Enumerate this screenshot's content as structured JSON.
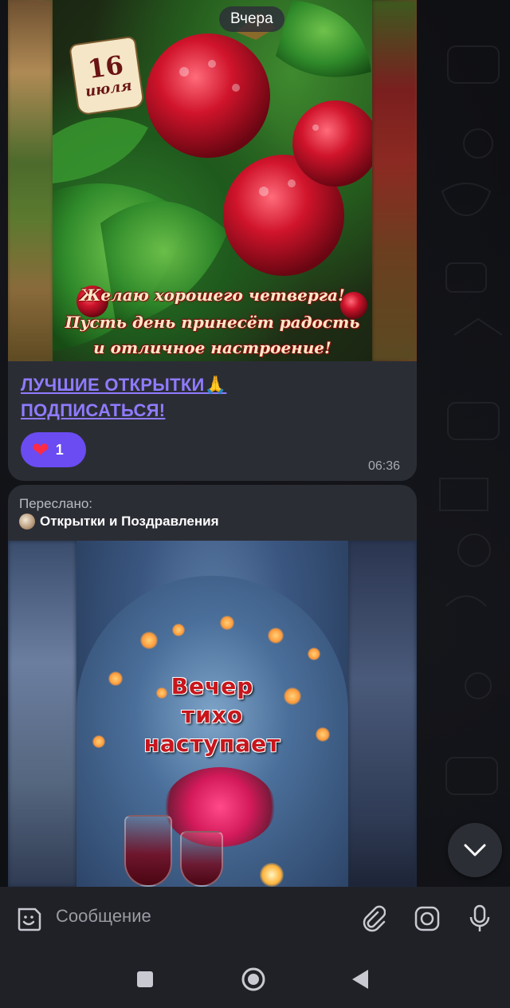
{
  "chat": {
    "date_separator": "Вчера",
    "message1": {
      "card": {
        "date_number": "16",
        "date_month": "июля",
        "greeting_lines": [
          "Желаю хорошего четверга!",
          "Пусть день принесёт радость",
          "и отличное настроение!"
        ]
      },
      "link_line1": "ЛУЧШИЕ ОТКРЫТКИ🙏",
      "link_line2": "ПОДПИСАТЬСЯ!",
      "reaction": {
        "emoji": "❤",
        "count": "1"
      },
      "time": "06:36"
    },
    "message2": {
      "forwarded_label": "Переслано:",
      "source_name": "Открытки и Поздравления",
      "video_text_lines": [
        "Вечер",
        "тихо",
        "наступает"
      ]
    }
  },
  "input": {
    "placeholder": "Сообщение",
    "icons": [
      "sticker-icon",
      "attach-icon",
      "camera-icon",
      "microphone-icon"
    ]
  },
  "navigation": {
    "icons": [
      "recents-square-icon",
      "home-circle-icon",
      "back-triangle-icon"
    ]
  },
  "colors": {
    "link": "#8f7bff",
    "reaction_bg": "#6a4cf2",
    "bubble_bg": "#2b2d35"
  }
}
